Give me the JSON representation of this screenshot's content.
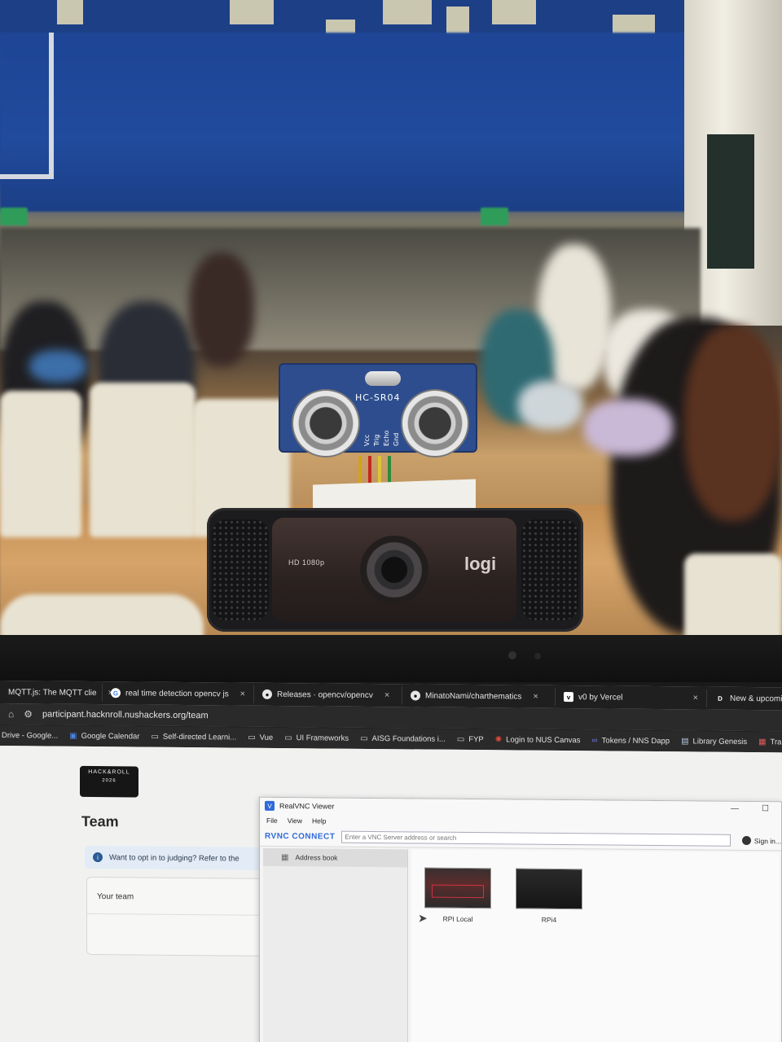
{
  "sensor": {
    "model": "HC-SR04",
    "pins": [
      "Vcc",
      "Trig",
      "Echo",
      "Gnd"
    ],
    "wire_colors": [
      "#d4a21a",
      "#c4281c",
      "#e0c234",
      "#2c8c3a"
    ]
  },
  "webcam": {
    "resolution": "HD 1080p",
    "brand": "logi"
  },
  "browser": {
    "tabs": [
      {
        "title": "MQTT.js: The MQTT clie",
        "icon": "mqtt-icon",
        "close": "×"
      },
      {
        "title": "real time detection opencv js us",
        "icon": "google-icon",
        "close": "×"
      },
      {
        "title": "Releases · opencv/opencv",
        "icon": "github-icon",
        "close": "×"
      },
      {
        "title": "MinatoNami/charthematics",
        "icon": "github-icon",
        "close": "×"
      },
      {
        "title": "v0 by Vercel",
        "icon": "v0-icon",
        "close": "×"
      },
      {
        "title": "New & upcomin",
        "icon": "d-icon",
        "close": ""
      }
    ],
    "url": "participant.hacknroll.nushackers.org/team",
    "bookmarks": [
      {
        "label": "Drive - Google...",
        "icon": "drive-icon"
      },
      {
        "label": "Google Calendar",
        "icon": "calendar-icon"
      },
      {
        "label": "Self-directed Learni...",
        "icon": "folder-icon"
      },
      {
        "label": "Vue",
        "icon": "folder-icon"
      },
      {
        "label": "UI Frameworks",
        "icon": "folder-icon"
      },
      {
        "label": "AISG Foundations i...",
        "icon": "folder-icon"
      },
      {
        "label": "FYP",
        "icon": "folder-icon"
      },
      {
        "label": "Login to NUS Canvas",
        "icon": "canvas-icon"
      },
      {
        "label": "Tokens / NNS Dapp",
        "icon": "nns-icon"
      },
      {
        "label": "Library Genesis",
        "icon": "library-icon"
      },
      {
        "label": "Tra",
        "icon": "bookmark-icon"
      }
    ]
  },
  "page": {
    "logo_text": "HACK&ROLL",
    "logo_year": "2026",
    "title": "Team",
    "alert_text": "Want to opt in to judging? Refer to the",
    "team_label": "Your team"
  },
  "vnc": {
    "window_title": "RealVNC Viewer",
    "menu": [
      "File",
      "View",
      "Help"
    ],
    "brand": "RVNC CONNECT",
    "search_placeholder": "Enter a VNC Server address or search",
    "sign_in": "Sign in...",
    "sidebar_item": "Address book",
    "computers": [
      {
        "name": "RPI Local"
      },
      {
        "name": "RPi4"
      }
    ]
  }
}
